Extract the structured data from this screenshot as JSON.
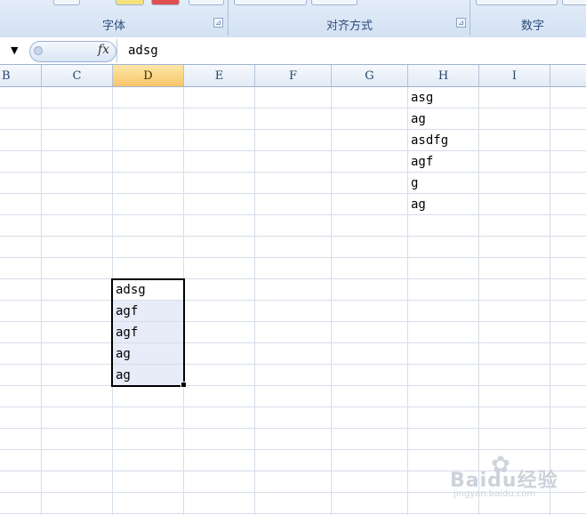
{
  "ribbon": {
    "groups": [
      {
        "label": "字体"
      },
      {
        "label": "对齐方式"
      },
      {
        "label": "数字"
      }
    ],
    "launcher_glyph": "⊿"
  },
  "formula_bar": {
    "dropdown_glyph": "▼",
    "fx_label": "fx",
    "content": "adsg"
  },
  "columns": [
    {
      "letter": "B"
    },
    {
      "letter": "C"
    },
    {
      "letter": "D",
      "active": true
    },
    {
      "letter": "E"
    },
    {
      "letter": "F"
    },
    {
      "letter": "G"
    },
    {
      "letter": "H"
    },
    {
      "letter": "I"
    }
  ],
  "cells": {
    "H": [
      "asg",
      "ag",
      "asdfg",
      "agf",
      "g",
      "ag"
    ],
    "D": [
      "adsg",
      "agf",
      "agf",
      "ag",
      "ag"
    ]
  },
  "watermark": {
    "text": "Baidu经验",
    "url": "jingyan.baidu.com"
  }
}
